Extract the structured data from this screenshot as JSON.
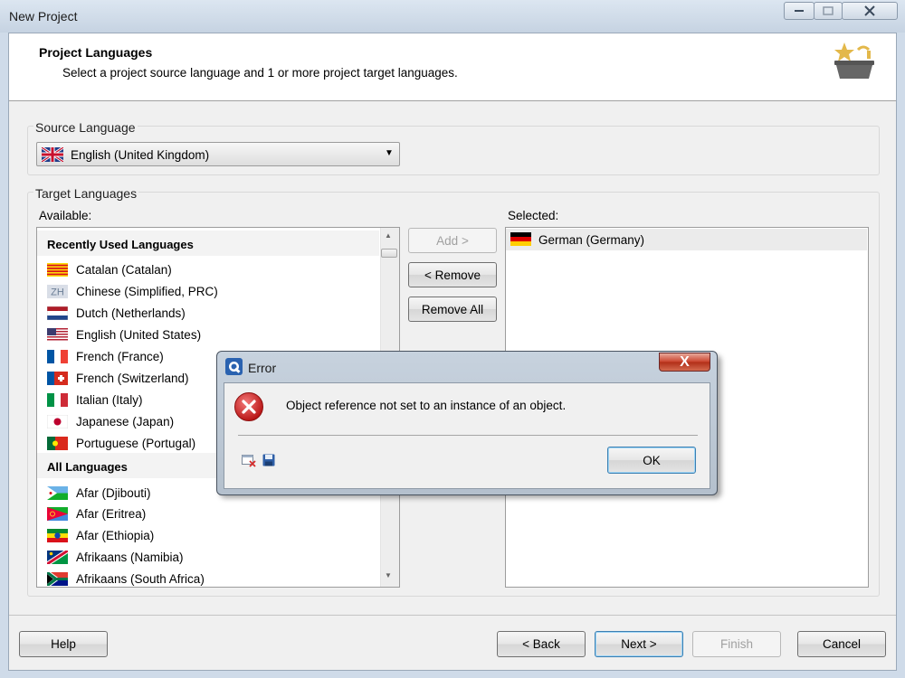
{
  "window": {
    "title": "New Project"
  },
  "header": {
    "title": "Project Languages",
    "description": "Select a project source language and 1 or more project target languages.",
    "icon": "wizard-star-icon"
  },
  "source": {
    "label": "Source Language",
    "value": "English (United Kingdom)",
    "flag_icon": "uk-flag-icon"
  },
  "target": {
    "label": "Target Languages",
    "available_label": "Available:",
    "selected_label": "Selected:",
    "recent_header": "Recently Used Languages",
    "all_header": "All Languages",
    "recent": [
      {
        "label": "Catalan (Catalan)",
        "flag": "catalonia-flag-icon"
      },
      {
        "label": "Chinese (Simplified, PRC)",
        "flag": "zh-text-flag-icon",
        "code": "ZH"
      },
      {
        "label": "Dutch (Netherlands)",
        "flag": "netherlands-flag-icon"
      },
      {
        "label": "English (United States)",
        "flag": "us-flag-icon"
      },
      {
        "label": "French (France)",
        "flag": "france-flag-icon"
      },
      {
        "label": "French (Switzerland)",
        "flag": "switzerland-flag-icon"
      },
      {
        "label": "Italian (Italy)",
        "flag": "italy-flag-icon"
      },
      {
        "label": "Japanese (Japan)",
        "flag": "japan-flag-icon"
      },
      {
        "label": "Portuguese (Portugal)",
        "flag": "portugal-flag-icon"
      }
    ],
    "all": [
      {
        "label": "Afar (Djibouti)",
        "flag": "djibouti-flag-icon"
      },
      {
        "label": "Afar (Eritrea)",
        "flag": "eritrea-flag-icon"
      },
      {
        "label": "Afar (Ethiopia)",
        "flag": "ethiopia-flag-icon"
      },
      {
        "label": "Afrikaans (Namibia)",
        "flag": "namibia-flag-icon"
      },
      {
        "label": "Afrikaans (South Africa)",
        "flag": "south-africa-flag-icon"
      }
    ],
    "selected": [
      {
        "label": "German (Germany)",
        "flag": "germany-flag-icon"
      }
    ],
    "buttons": {
      "add": "Add >",
      "remove": "< Remove",
      "remove_all": "Remove All"
    }
  },
  "footer": {
    "help": "Help",
    "back": "< Back",
    "next": "Next >",
    "finish": "Finish",
    "cancel": "Cancel"
  },
  "dialog": {
    "title": "Error",
    "message": "Object reference not set to an instance of an object.",
    "ok": "OK",
    "close_glyph": "X"
  },
  "colors": {
    "accent_border": "#3c7fb1",
    "error_red": "#d42b2b",
    "close_red": "#c9412a"
  }
}
